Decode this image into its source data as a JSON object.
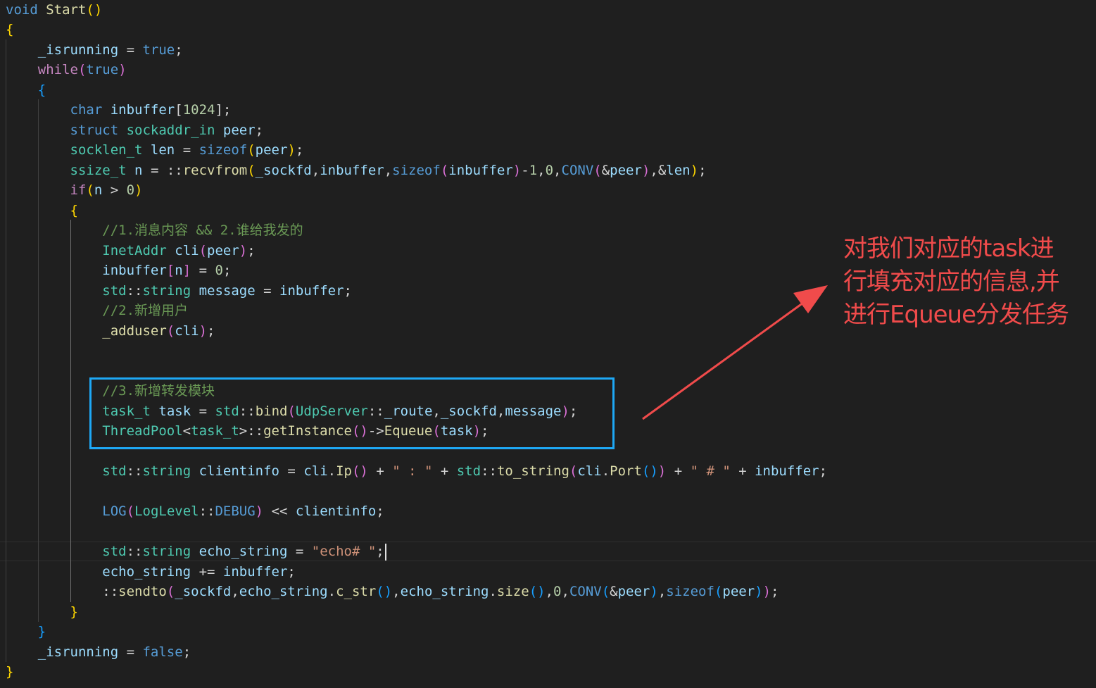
{
  "colors": {
    "background": "#1f1f1f",
    "highlight_box": "#1ea8f5",
    "annotation": "#f04b4b"
  },
  "annotation": {
    "lines": [
      "对我们对应的task进",
      "行填充对应的信息,并",
      "进行Equeue分发任务"
    ]
  },
  "code": {
    "lines": [
      [
        {
          "t": "void",
          "c": "keyword"
        },
        {
          "t": " "
        },
        {
          "t": "Start",
          "c": "function"
        },
        {
          "t": "()",
          "c": "brace-gold"
        }
      ],
      [
        {
          "t": "{",
          "c": "brace-gold"
        }
      ],
      [
        {
          "t": "    "
        },
        {
          "t": "_isrunning",
          "c": "variable"
        },
        {
          "t": " = "
        },
        {
          "t": "true",
          "c": "keyword"
        },
        {
          "t": ";"
        }
      ],
      [
        {
          "t": "    "
        },
        {
          "t": "while",
          "c": "control"
        },
        {
          "t": "(",
          "c": "brace-pink"
        },
        {
          "t": "true",
          "c": "keyword"
        },
        {
          "t": ")",
          "c": "brace-pink"
        }
      ],
      [
        {
          "t": "    "
        },
        {
          "t": "{",
          "c": "brace-blue"
        }
      ],
      [
        {
          "t": "        "
        },
        {
          "t": "char",
          "c": "keyword"
        },
        {
          "t": " "
        },
        {
          "t": "inbuffer",
          "c": "variable"
        },
        {
          "t": "["
        },
        {
          "t": "1024",
          "c": "number"
        },
        {
          "t": "];"
        }
      ],
      [
        {
          "t": "        "
        },
        {
          "t": "struct",
          "c": "keyword"
        },
        {
          "t": " "
        },
        {
          "t": "sockaddr_in",
          "c": "type"
        },
        {
          "t": " "
        },
        {
          "t": "peer",
          "c": "variable"
        },
        {
          "t": ";"
        }
      ],
      [
        {
          "t": "        "
        },
        {
          "t": "socklen_t",
          "c": "type"
        },
        {
          "t": " "
        },
        {
          "t": "len",
          "c": "variable"
        },
        {
          "t": " = "
        },
        {
          "t": "sizeof",
          "c": "keyword"
        },
        {
          "t": "(",
          "c": "brace-gold"
        },
        {
          "t": "peer",
          "c": "variable"
        },
        {
          "t": ")",
          "c": "brace-gold"
        },
        {
          "t": ";"
        }
      ],
      [
        {
          "t": "        "
        },
        {
          "t": "ssize_t",
          "c": "type"
        },
        {
          "t": " "
        },
        {
          "t": "n",
          "c": "variable"
        },
        {
          "t": " = ::"
        },
        {
          "t": "recvfrom",
          "c": "function"
        },
        {
          "t": "(",
          "c": "brace-gold"
        },
        {
          "t": "_sockfd",
          "c": "variable"
        },
        {
          "t": ","
        },
        {
          "t": "inbuffer",
          "c": "variable"
        },
        {
          "t": ","
        },
        {
          "t": "sizeof",
          "c": "keyword"
        },
        {
          "t": "(",
          "c": "brace-pink"
        },
        {
          "t": "inbuffer",
          "c": "variable"
        },
        {
          "t": ")",
          "c": "brace-pink"
        },
        {
          "t": "-"
        },
        {
          "t": "1",
          "c": "number"
        },
        {
          "t": ","
        },
        {
          "t": "0",
          "c": "number"
        },
        {
          "t": ","
        },
        {
          "t": "CONV",
          "c": "macro"
        },
        {
          "t": "(",
          "c": "brace-pink"
        },
        {
          "t": "&"
        },
        {
          "t": "peer",
          "c": "variable"
        },
        {
          "t": ")",
          "c": "brace-pink"
        },
        {
          "t": ",&"
        },
        {
          "t": "len",
          "c": "variable"
        },
        {
          "t": ")",
          "c": "brace-gold"
        },
        {
          "t": ";"
        }
      ],
      [
        {
          "t": "        "
        },
        {
          "t": "if",
          "c": "control"
        },
        {
          "t": "(",
          "c": "brace-gold"
        },
        {
          "t": "n",
          "c": "variable"
        },
        {
          "t": " > "
        },
        {
          "t": "0",
          "c": "number"
        },
        {
          "t": ")",
          "c": "brace-gold"
        }
      ],
      [
        {
          "t": "        "
        },
        {
          "t": "{",
          "c": "brace-gold"
        }
      ],
      [
        {
          "t": "            "
        },
        {
          "t": "//1.消息内容 && 2.谁给我发的",
          "c": "comment"
        }
      ],
      [
        {
          "t": "            "
        },
        {
          "t": "InetAddr",
          "c": "type"
        },
        {
          "t": " "
        },
        {
          "t": "cli",
          "c": "variable"
        },
        {
          "t": "(",
          "c": "brace-pink"
        },
        {
          "t": "peer",
          "c": "variable"
        },
        {
          "t": ")",
          "c": "brace-pink"
        },
        {
          "t": ";"
        }
      ],
      [
        {
          "t": "            "
        },
        {
          "t": "inbuffer",
          "c": "variable"
        },
        {
          "t": "[",
          "c": "brace-pink"
        },
        {
          "t": "n",
          "c": "variable"
        },
        {
          "t": "]",
          "c": "brace-pink"
        },
        {
          "t": " = "
        },
        {
          "t": "0",
          "c": "number"
        },
        {
          "t": ";"
        }
      ],
      [
        {
          "t": "            "
        },
        {
          "t": "std",
          "c": "type"
        },
        {
          "t": "::"
        },
        {
          "t": "string",
          "c": "type"
        },
        {
          "t": " "
        },
        {
          "t": "message",
          "c": "variable"
        },
        {
          "t": " = "
        },
        {
          "t": "inbuffer",
          "c": "variable"
        },
        {
          "t": ";"
        }
      ],
      [
        {
          "t": "            "
        },
        {
          "t": "//2.新增用户",
          "c": "comment"
        }
      ],
      [
        {
          "t": "            "
        },
        {
          "t": "_adduser",
          "c": "function"
        },
        {
          "t": "(",
          "c": "brace-pink"
        },
        {
          "t": "cli",
          "c": "variable"
        },
        {
          "t": ")",
          "c": "brace-pink"
        },
        {
          "t": ";"
        }
      ],
      [],
      [],
      [
        {
          "t": "            "
        },
        {
          "t": "//3.新增转发模块",
          "c": "comment"
        }
      ],
      [
        {
          "t": "            "
        },
        {
          "t": "task_t",
          "c": "type"
        },
        {
          "t": " "
        },
        {
          "t": "task",
          "c": "variable"
        },
        {
          "t": " = "
        },
        {
          "t": "std",
          "c": "type"
        },
        {
          "t": "::"
        },
        {
          "t": "bind",
          "c": "function"
        },
        {
          "t": "(",
          "c": "brace-pink"
        },
        {
          "t": "UdpServer",
          "c": "type"
        },
        {
          "t": "::"
        },
        {
          "t": "_route",
          "c": "variable"
        },
        {
          "t": ","
        },
        {
          "t": "_sockfd",
          "c": "variable"
        },
        {
          "t": ","
        },
        {
          "t": "message",
          "c": "variable"
        },
        {
          "t": ")",
          "c": "brace-pink"
        },
        {
          "t": ";"
        }
      ],
      [
        {
          "t": "            "
        },
        {
          "t": "ThreadPool",
          "c": "type"
        },
        {
          "t": "<"
        },
        {
          "t": "task_t",
          "c": "type"
        },
        {
          "t": ">::"
        },
        {
          "t": "getInstance",
          "c": "function"
        },
        {
          "t": "()",
          "c": "brace-pink"
        },
        {
          "t": "->"
        },
        {
          "t": "Equeue",
          "c": "function"
        },
        {
          "t": "(",
          "c": "brace-pink"
        },
        {
          "t": "task",
          "c": "variable"
        },
        {
          "t": ")",
          "c": "brace-pink"
        },
        {
          "t": ";"
        }
      ],
      [],
      [
        {
          "t": "            "
        },
        {
          "t": "std",
          "c": "type"
        },
        {
          "t": "::"
        },
        {
          "t": "string",
          "c": "type"
        },
        {
          "t": " "
        },
        {
          "t": "clientinfo",
          "c": "variable"
        },
        {
          "t": " = "
        },
        {
          "t": "cli",
          "c": "variable"
        },
        {
          "t": "."
        },
        {
          "t": "Ip",
          "c": "function"
        },
        {
          "t": "()",
          "c": "brace-pink"
        },
        {
          "t": " + "
        },
        {
          "t": "\" : \"",
          "c": "string"
        },
        {
          "t": " + "
        },
        {
          "t": "std",
          "c": "type"
        },
        {
          "t": "::"
        },
        {
          "t": "to_string",
          "c": "function"
        },
        {
          "t": "(",
          "c": "brace-pink"
        },
        {
          "t": "cli",
          "c": "variable"
        },
        {
          "t": "."
        },
        {
          "t": "Port",
          "c": "function"
        },
        {
          "t": "()",
          "c": "brace-blue"
        },
        {
          "t": ")",
          "c": "brace-pink"
        },
        {
          "t": " + "
        },
        {
          "t": "\" # \"",
          "c": "string"
        },
        {
          "t": " + "
        },
        {
          "t": "inbuffer",
          "c": "variable"
        },
        {
          "t": ";"
        }
      ],
      [],
      [
        {
          "t": "            "
        },
        {
          "t": "LOG",
          "c": "macro"
        },
        {
          "t": "(",
          "c": "brace-pink"
        },
        {
          "t": "LogLevel",
          "c": "type"
        },
        {
          "t": "::"
        },
        {
          "t": "DEBUG",
          "c": "keyword"
        },
        {
          "t": ")",
          "c": "brace-pink"
        },
        {
          "t": " << "
        },
        {
          "t": "clientinfo",
          "c": "variable"
        },
        {
          "t": ";"
        }
      ],
      [],
      [
        {
          "t": "            "
        },
        {
          "t": "std",
          "c": "type"
        },
        {
          "t": "::"
        },
        {
          "t": "string",
          "c": "type"
        },
        {
          "t": " "
        },
        {
          "t": "echo_string",
          "c": "variable"
        },
        {
          "t": " = "
        },
        {
          "t": "\"echo# \"",
          "c": "string"
        },
        {
          "t": ";"
        }
      ],
      [
        {
          "t": "            "
        },
        {
          "t": "echo_string",
          "c": "variable"
        },
        {
          "t": " += "
        },
        {
          "t": "inbuffer",
          "c": "variable"
        },
        {
          "t": ";"
        }
      ],
      [
        {
          "t": "            ::"
        },
        {
          "t": "sendto",
          "c": "function"
        },
        {
          "t": "(",
          "c": "brace-pink"
        },
        {
          "t": "_sockfd",
          "c": "variable"
        },
        {
          "t": ","
        },
        {
          "t": "echo_string",
          "c": "variable"
        },
        {
          "t": "."
        },
        {
          "t": "c_str",
          "c": "function"
        },
        {
          "t": "()",
          "c": "brace-blue"
        },
        {
          "t": ","
        },
        {
          "t": "echo_string",
          "c": "variable"
        },
        {
          "t": "."
        },
        {
          "t": "size",
          "c": "function"
        },
        {
          "t": "()",
          "c": "brace-blue"
        },
        {
          "t": ","
        },
        {
          "t": "0",
          "c": "number"
        },
        {
          "t": ","
        },
        {
          "t": "CONV",
          "c": "macro"
        },
        {
          "t": "(",
          "c": "brace-blue"
        },
        {
          "t": "&"
        },
        {
          "t": "peer",
          "c": "variable"
        },
        {
          "t": ")",
          "c": "brace-blue"
        },
        {
          "t": ","
        },
        {
          "t": "sizeof",
          "c": "keyword"
        },
        {
          "t": "(",
          "c": "brace-blue"
        },
        {
          "t": "peer",
          "c": "variable"
        },
        {
          "t": ")",
          "c": "brace-blue"
        },
        {
          "t": ")",
          "c": "brace-pink"
        },
        {
          "t": ";"
        }
      ],
      [
        {
          "t": "        "
        },
        {
          "t": "}",
          "c": "brace-gold"
        }
      ],
      [
        {
          "t": "    "
        },
        {
          "t": "}",
          "c": "brace-blue"
        }
      ],
      [
        {
          "t": "    "
        },
        {
          "t": "_isrunning",
          "c": "variable"
        },
        {
          "t": " = "
        },
        {
          "t": "false",
          "c": "keyword"
        },
        {
          "t": ";"
        }
      ],
      [
        {
          "t": "}",
          "c": "brace-gold"
        }
      ]
    ]
  }
}
